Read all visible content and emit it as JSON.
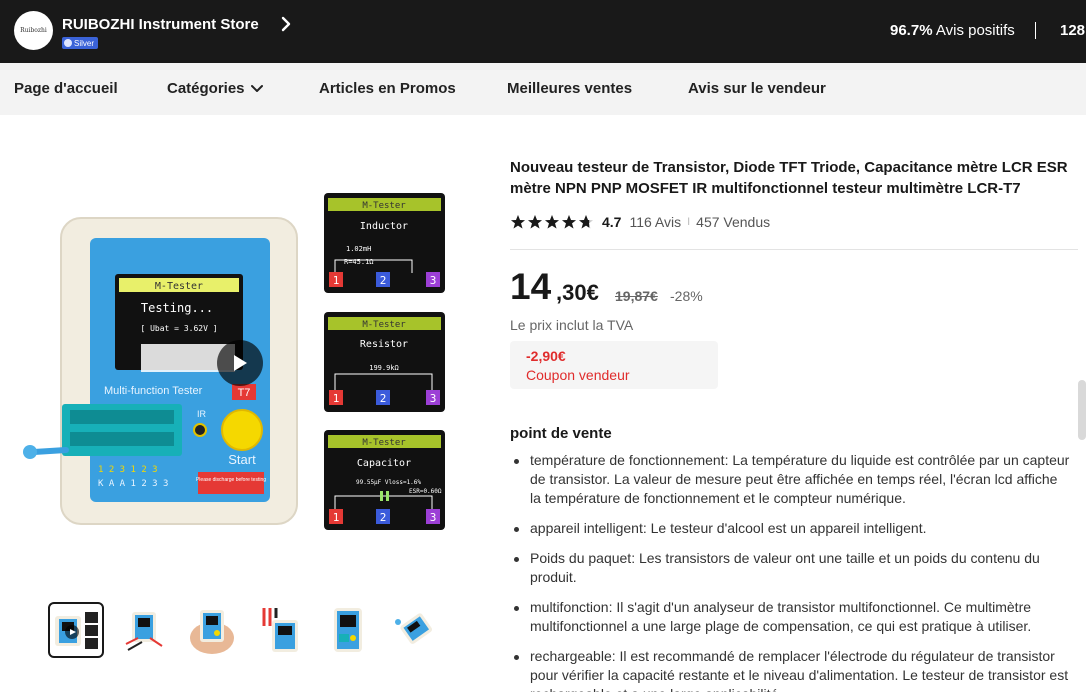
{
  "store": {
    "logo_text": "Ruibozhi",
    "name": "RUIBOZHI Instrument Store",
    "badge": "Silver",
    "positive_pct": "96.7%",
    "positive_label": "Avis positifs",
    "followers": "128"
  },
  "nav": {
    "items": [
      "Page d'accueil",
      "Catégories",
      "Articles en Promos",
      "Meilleures ventes",
      "Avis sur le vendeur"
    ]
  },
  "product": {
    "title": "Nouveau testeur de Transistor, Diode TFT Triode, Capacitance mètre LCR ESR mètre NPN PNP MOSFET IR multifonctionnel testeur multimètre LCR-T7",
    "rating": "4.7",
    "star_rating": 4.7,
    "reviews": "116 Avis",
    "separator": "I",
    "sold": "457 Vendus",
    "price_int": "14",
    "price_dec": ",30€",
    "price_old": "19,87€",
    "discount": "-28%",
    "vat_note": "Le prix inclut la TVA",
    "coupon_amount": "-2,90€",
    "coupon_label": "Coupon vendeur",
    "highlights_title": "point de vente",
    "highlights": [
      "température de fonctionnement: La température du liquide est contrôlée par un capteur de transistor. La valeur de mesure peut être affichée en temps réel, l'écran lcd affiche la température de fonctionnement et le compteur numérique.",
      "appareil intelligent: Le testeur d'alcool est un appareil intelligent.",
      "Poids du paquet: Les transistors de valeur ont une taille et un poids du contenu du produit.",
      "multifonction: Il s'agit d'un analyseur de transistor multifonctionnel. Ce multimètre multifonctionnel a une large plage de compensation, ce qui est pratique à utiliser.",
      "rechargeable: Il est recommandé de remplacer l'électrode du régulateur de transistor pour vérifier la capacité restante et le niveau d'alimentation. Le testeur de transistor est rechargeable et a une large applicabilité."
    ]
  },
  "image": {
    "device": {
      "screen_title": "M-Tester",
      "screen_line1": "Testing...",
      "screen_line2": "[ Ubat = 3.62V ]",
      "panel_label": "Multi-function Tester",
      "model": "T7",
      "ir_label": "IR",
      "start_label": "Start",
      "pins_row1": "1 2 3 1 2 3",
      "pins_row2": "K A A 1 2 3 3",
      "warning": "Please discharge before testing"
    },
    "panels": [
      {
        "title": "M-Tester",
        "label": "Inductor",
        "value1": "1.02mH",
        "value2": "R=45.1Ω"
      },
      {
        "title": "M-Tester",
        "label": "Resistor",
        "value1": "199.9kΩ",
        "value2": ""
      },
      {
        "title": "M-Tester",
        "label": "Capacitor",
        "value1": "99.55µF  Vloss=1.6%",
        "value2": "ESR=0.60Ω"
      }
    ],
    "pin_numbers": [
      "1",
      "2",
      "3"
    ]
  },
  "colors": {
    "header_bg": "#191919",
    "nav_bg": "#f3f3f3",
    "coupon_red": "#e02c2c",
    "badge_blue": "#3b63d8",
    "device_blue": "#3aa0e0",
    "button_yellow": "#f5d800"
  },
  "thumbnails": [
    "video-thumbnail",
    "tester-with-probes",
    "tester-in-hand",
    "tester-with-clips",
    "tester-front",
    "tester-angled"
  ]
}
